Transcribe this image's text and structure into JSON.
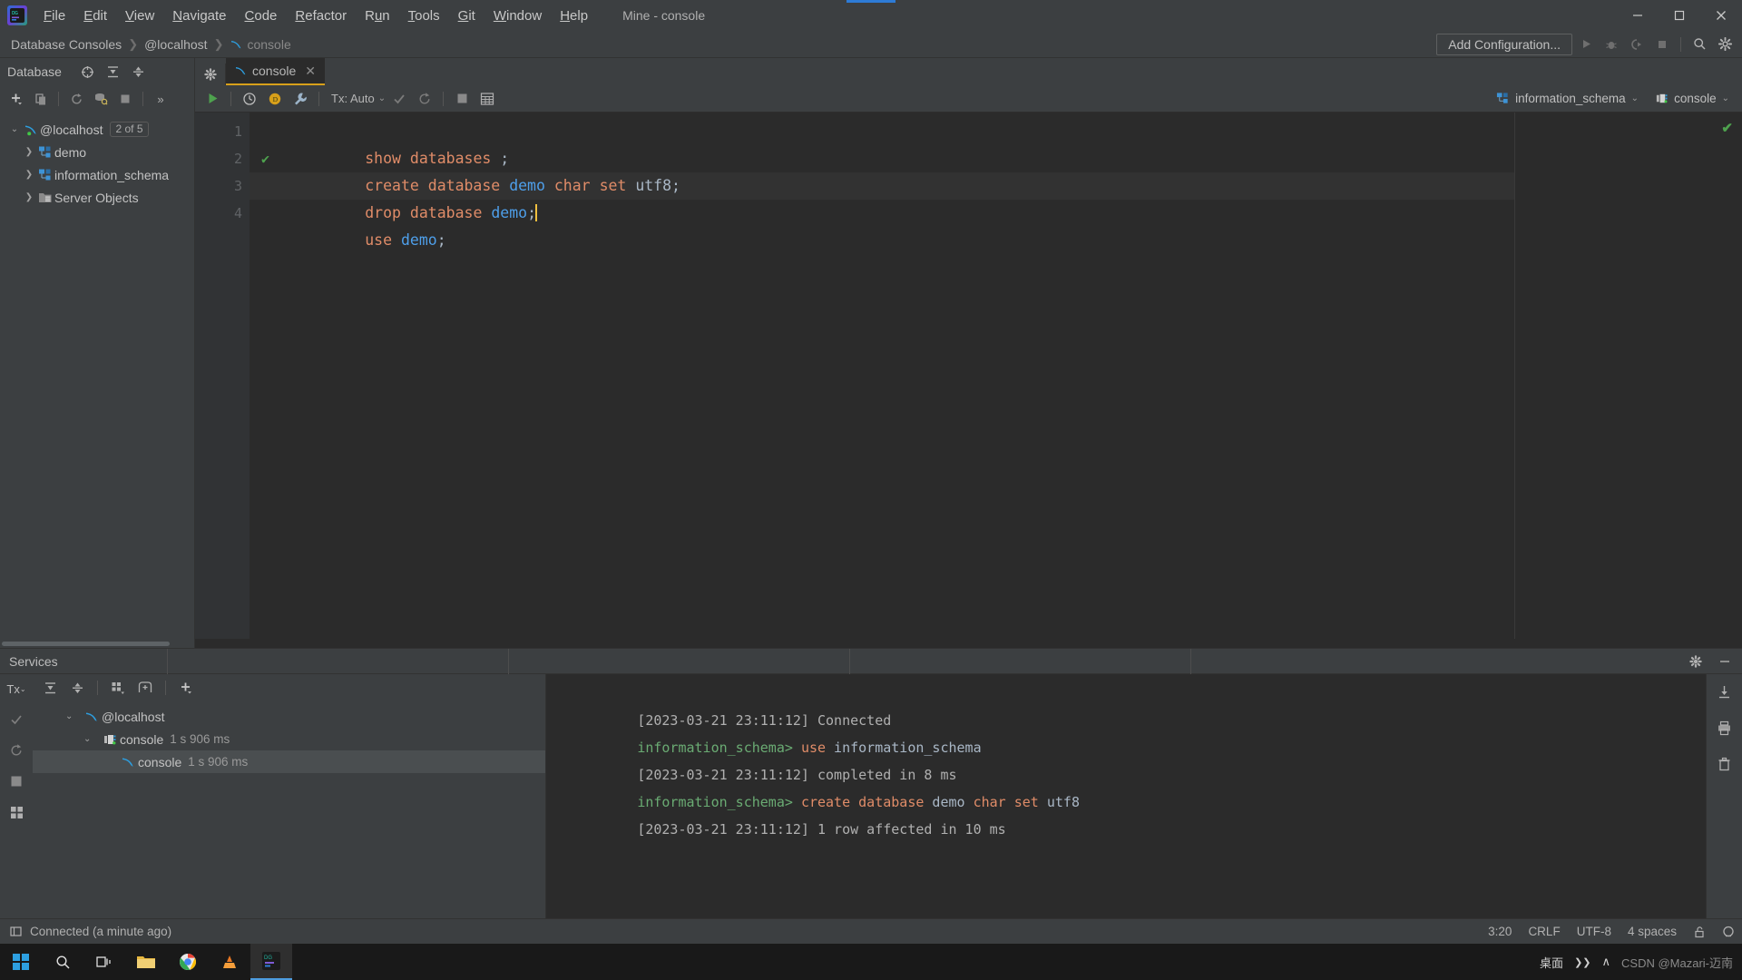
{
  "window": {
    "title": "Mine - console",
    "app_icon": "datagrip-logo-icon",
    "minimize": "−",
    "maximize": "▢",
    "close": "✕"
  },
  "menu": [
    {
      "label": "File",
      "mnemonic": "F"
    },
    {
      "label": "Edit",
      "mnemonic": "E"
    },
    {
      "label": "View",
      "mnemonic": "V"
    },
    {
      "label": "Navigate",
      "mnemonic": "N"
    },
    {
      "label": "Code",
      "mnemonic": "C"
    },
    {
      "label": "Refactor",
      "mnemonic": "R"
    },
    {
      "label": "Run",
      "mnemonic": "u"
    },
    {
      "label": "Tools",
      "mnemonic": "T"
    },
    {
      "label": "Git",
      "mnemonic": "G"
    },
    {
      "label": "Window",
      "mnemonic": "W"
    },
    {
      "label": "Help",
      "mnemonic": "H"
    }
  ],
  "breadcrumb": {
    "items": [
      "Database Consoles",
      "@localhost",
      "console"
    ],
    "separator": "❯"
  },
  "navbar_right": {
    "add_configuration": "Add Configuration...",
    "buttons": [
      "run-icon",
      "debug-icon",
      "run-with-coverage-icon",
      "stop-icon",
      "search-icon",
      "settings-icon"
    ]
  },
  "database_panel": {
    "title": "Database",
    "header_icons": [
      "target-icon",
      "expand-all-icon",
      "collapse-all-icon",
      "settings-gear-icon"
    ],
    "toolbar_icons": [
      "add-icon",
      "copy-icon",
      "refresh-icon",
      "sync-icon",
      "stop-icon",
      "more-icon"
    ],
    "tree": [
      {
        "label": "@localhost",
        "badge": "2 of 5",
        "icon": "mysql-dolphin-icon",
        "arrow": "⌄",
        "level": 0
      },
      {
        "label": "demo",
        "icon": "schema-icon",
        "arrow": "❯",
        "level": 1
      },
      {
        "label": "information_schema",
        "icon": "schema-icon",
        "arrow": "❯",
        "level": 1
      },
      {
        "label": "Server Objects",
        "icon": "folder-objects-icon",
        "arrow": "❯",
        "level": 1
      }
    ]
  },
  "editor_tab": {
    "label": "console",
    "icon": "mysql-dolphin-icon",
    "close": "✕"
  },
  "editor_toolbar": {
    "execute": "run-icon",
    "history": "history-icon",
    "db_mode": "postgres-mode-icon",
    "wrench": "wrench-icon",
    "tx_label": "Tx: Auto",
    "commit": "commit-check-icon",
    "rollback": "rollback-icon",
    "stop": "stop-icon",
    "grid": "grid-icon",
    "schema_selector": "information_schema",
    "console_selector": "console"
  },
  "code": {
    "lines": [
      {
        "number": "1",
        "current": false,
        "ok": false,
        "tokens": [
          {
            "t": "show",
            "c": "kw"
          },
          {
            "t": " ",
            "c": "pl"
          },
          {
            "t": "databases",
            "c": "kw"
          },
          {
            "t": " ;",
            "c": "pl"
          }
        ]
      },
      {
        "number": "2",
        "current": false,
        "ok": true,
        "tokens": [
          {
            "t": "create",
            "c": "kw"
          },
          {
            "t": " ",
            "c": "pl"
          },
          {
            "t": "database",
            "c": "kw"
          },
          {
            "t": " ",
            "c": "pl"
          },
          {
            "t": "demo",
            "c": "id"
          },
          {
            "t": " ",
            "c": "pl"
          },
          {
            "t": "char",
            "c": "kw"
          },
          {
            "t": " ",
            "c": "pl"
          },
          {
            "t": "set",
            "c": "kw"
          },
          {
            "t": " ",
            "c": "pl"
          },
          {
            "t": "utf8;",
            "c": "pl"
          }
        ]
      },
      {
        "number": "3",
        "current": true,
        "ok": false,
        "caret": true,
        "tokens": [
          {
            "t": "drop",
            "c": "kw"
          },
          {
            "t": " ",
            "c": "pl"
          },
          {
            "t": "database",
            "c": "kw"
          },
          {
            "t": " ",
            "c": "pl"
          },
          {
            "t": "demo",
            "c": "id"
          },
          {
            "t": ";",
            "c": "pl"
          }
        ]
      },
      {
        "number": "4",
        "current": false,
        "ok": false,
        "tokens": [
          {
            "t": "use",
            "c": "kw"
          },
          {
            "t": " ",
            "c": "pl"
          },
          {
            "t": "demo",
            "c": "id"
          },
          {
            "t": ";",
            "c": "pl"
          }
        ]
      }
    ],
    "inspection_ok": "✔"
  },
  "services": {
    "title": "Services",
    "header_icons": [
      "settings-gear-icon",
      "hide-icon"
    ],
    "left_rail": [
      "tx-icon",
      "commit-check-icon",
      "rollback-icon",
      "stop-icon",
      "layout-icon"
    ],
    "toolbar_icons": [
      "expand-all-icon",
      "collapse-all-icon",
      "group-by-icon",
      "add-tab-icon",
      "add-icon"
    ],
    "tree": [
      {
        "label": "@localhost",
        "time": "",
        "icon": "mysql-dolphin-icon",
        "arrow": "⌄",
        "level": 0,
        "selected": false
      },
      {
        "label": "console",
        "time": "1 s 906 ms",
        "icon": "console-icon",
        "arrow": "⌄",
        "level": 1,
        "selected": false
      },
      {
        "label": "console",
        "time": "1 s 906 ms",
        "icon": "mysql-dolphin-icon",
        "arrow": "",
        "level": 2,
        "selected": true
      }
    ],
    "output": [
      {
        "segments": [
          {
            "t": "[2023-03-21 23:11:12] Connected",
            "c": "o-ts"
          }
        ]
      },
      {
        "segments": [
          {
            "t": "information_schema>",
            "c": "o-prompt"
          },
          {
            "t": " ",
            "c": "o-id"
          },
          {
            "t": "use",
            "c": "o-kw"
          },
          {
            "t": " information_schema",
            "c": "o-id"
          }
        ]
      },
      {
        "segments": [
          {
            "t": "[2023-03-21 23:11:12] completed in 8 ms",
            "c": "o-ts"
          }
        ]
      },
      {
        "segments": [
          {
            "t": "information_schema>",
            "c": "o-prompt"
          },
          {
            "t": " ",
            "c": "o-id"
          },
          {
            "t": "create",
            "c": "o-kw"
          },
          {
            "t": " ",
            "c": "o-id"
          },
          {
            "t": "database",
            "c": "o-kw"
          },
          {
            "t": " demo ",
            "c": "o-id"
          },
          {
            "t": "char",
            "c": "o-kw"
          },
          {
            "t": " ",
            "c": "o-id"
          },
          {
            "t": "set",
            "c": "o-kw"
          },
          {
            "t": " utf8",
            "c": "o-id"
          }
        ]
      },
      {
        "segments": [
          {
            "t": "[2023-03-21 23:11:12] 1 row affected in 10 ms",
            "c": "o-ts"
          }
        ]
      }
    ],
    "right_rail": [
      "export-icon",
      "print-icon",
      "delete-icon"
    ]
  },
  "statusbar": {
    "left_icon": "toggle-panel-icon",
    "connection": "Connected (a minute ago)",
    "caret_position": "3:20",
    "line_separator": "CRLF",
    "encoding": "UTF-8",
    "indent": "4 spaces",
    "lock_icon": "unlocked-icon",
    "notifications_icon": "notifications-icon"
  },
  "taskbar": {
    "items": [
      "start-icon",
      "search-icon",
      "task-view-icon",
      "explorer-icon",
      "chrome-icon",
      "vlc-icon",
      "datagrip-icon"
    ],
    "tray": {
      "desktop_label": "桌面",
      "expand": "❯❯",
      "chevron": "∧",
      "watermark": "CSDN @Mazari-迈南"
    }
  },
  "colors": {
    "background": "#3c3f41",
    "editor_bg": "#2b2b2b",
    "accent_tab": "#d8a01a",
    "keyword": "#e08c68",
    "identifier": "#4e9fea",
    "plain": "#a9b7c6",
    "success": "#4ea24e",
    "prompt": "#6aab73",
    "caret": "#f0c040"
  }
}
